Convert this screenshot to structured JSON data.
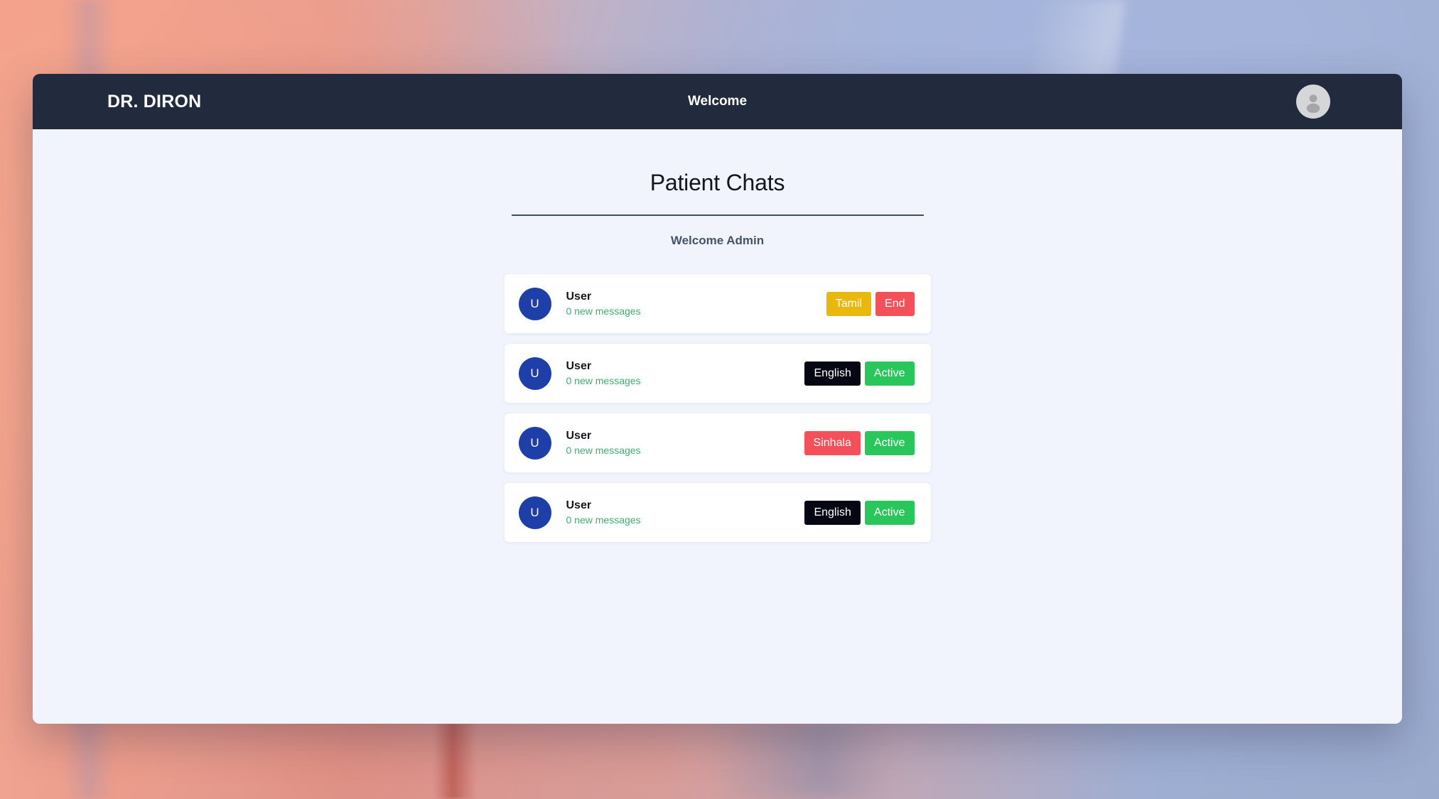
{
  "navbar": {
    "brand": "DR. DIRON",
    "title": "Welcome",
    "avatar_icon": "user-avatar-icon"
  },
  "page": {
    "title": "Patient Chats",
    "welcome": "Welcome Admin"
  },
  "chats": [
    {
      "avatar_initial": "U",
      "name": "User",
      "messages": "0 new messages",
      "language_label": "Tamil",
      "language_color": "#e8b80c",
      "status_label": "End",
      "status_color": "#f4505a"
    },
    {
      "avatar_initial": "U",
      "name": "User",
      "messages": "0 new messages",
      "language_label": "English",
      "language_color": "#050713",
      "status_label": "Active",
      "status_color": "#28c65b"
    },
    {
      "avatar_initial": "U",
      "name": "User",
      "messages": "0 new messages",
      "language_label": "Sinhala",
      "language_color": "#f4505a",
      "status_label": "Active",
      "status_color": "#28c65b"
    },
    {
      "avatar_initial": "U",
      "name": "User",
      "messages": "0 new messages",
      "language_label": "English",
      "language_color": "#050713",
      "status_label": "Active",
      "status_color": "#28c65b"
    }
  ],
  "theme": {
    "navbar_bg": "#212b3d",
    "content_bg": "#f1f4fd",
    "avatar_bg": "#1e3fa8",
    "sub_text": "#3fae72"
  }
}
